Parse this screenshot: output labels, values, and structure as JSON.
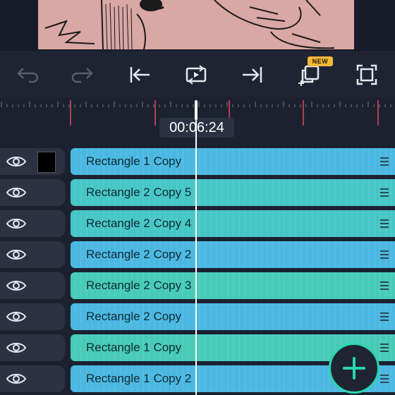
{
  "toolbar": {
    "new_badge": "NEW",
    "icons": [
      "undo-icon",
      "redo-icon",
      "jump-start-icon",
      "loop-icon",
      "jump-end-icon",
      "duplicate-icon",
      "fullscreen-icon"
    ]
  },
  "timeline": {
    "current_time": "00:06:24"
  },
  "layers": [
    {
      "name": "Rectangle 1 Copy",
      "visible": true,
      "color": "#4bb8e2"
    },
    {
      "name": "Rectangle 2 Copy 5",
      "visible": true,
      "color": "#46c7c6"
    },
    {
      "name": "Rectangle 2 Copy 4",
      "visible": true,
      "color": "#46c7c6"
    },
    {
      "name": "Rectangle 2 Copy 2",
      "visible": true,
      "color": "#4bb8e2"
    },
    {
      "name": "Rectangle 2 Copy 3",
      "visible": true,
      "color": "#47cbb8"
    },
    {
      "name": "Rectangle 2 Copy",
      "visible": true,
      "color": "#4bb8e2"
    },
    {
      "name": "Rectangle 1 Copy",
      "visible": true,
      "color": "#47cbb8"
    },
    {
      "name": "Rectangle 1 Copy 2",
      "visible": true,
      "color": "#4bb8e2"
    }
  ],
  "colors": {
    "accent": "#29d6b0",
    "track_blue": "#4bb8e2",
    "track_teal": "#47cbb8",
    "keyframe_marker": "#e04a5f",
    "badge": "#f3b73a"
  }
}
